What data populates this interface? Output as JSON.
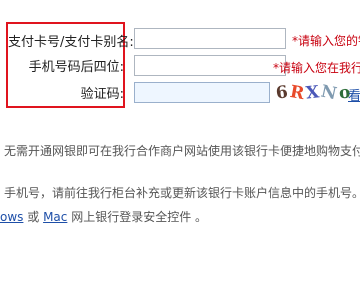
{
  "form": {
    "card_label": "支付卡号/支付卡别名:",
    "card_hint": "*请输入您的银",
    "card_value": "",
    "phone_label": "手机号码后四位:",
    "phone_hint": "*请输入您在我行",
    "phone_value": "",
    "captcha_label": "验证码:",
    "captcha_value": "",
    "captcha_chars": [
      "6",
      "R",
      "X",
      "N",
      "o"
    ],
    "captcha_refresh": "看"
  },
  "info": {
    "line1": "无需开通网银即可在我行合作商户网站使用该银行卡便捷地购物支付",
    "line2": "手机号，请前往我行柜台补充或更新该银行卡账户信息中的手机号。",
    "line3_link1": "ows",
    "line3_mid": " 或 ",
    "line3_link2": "Mac",
    "line3_rest": " 网上银行登录安全控件 。"
  },
  "colors": {
    "highlight": "#e0141e",
    "hint_red": "#c8000f",
    "link_blue": "#1e4fa8"
  }
}
